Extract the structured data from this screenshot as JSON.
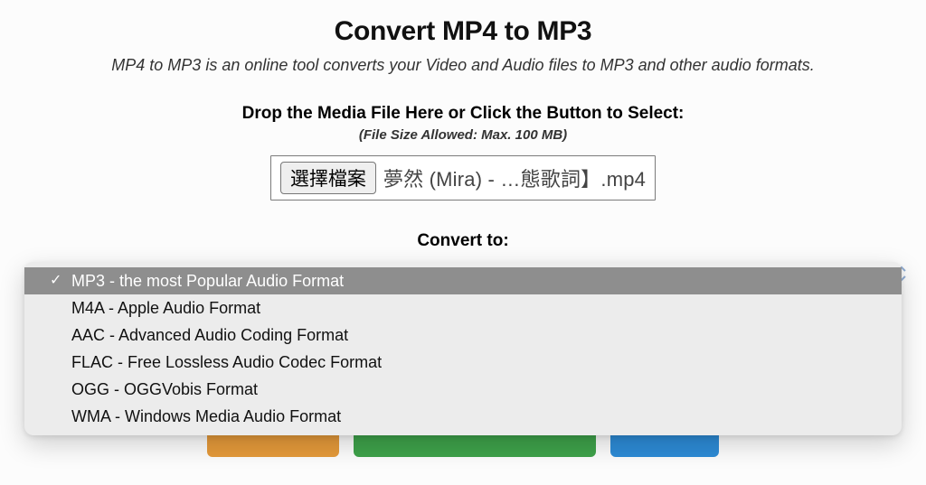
{
  "header": {
    "title": "Convert MP4 to MP3",
    "description": "MP4 to MP3 is an online tool converts your Video and Audio files to MP3 and other audio formats."
  },
  "upload": {
    "drop_label": "Drop the Media File Here or Click the Button to Select:",
    "size_note": "(File Size Allowed: Max. 100 MB)",
    "choose_button_label": "選擇檔案",
    "selected_file_display": "夢然 (Mira) - …態歌詞】.mp4"
  },
  "convert": {
    "label": "Convert to:",
    "options": [
      "MP3 - the most Popular Audio Format",
      "M4A - Apple Audio Format",
      "AAC - Advanced Audio Coding Format",
      "FLAC - Free Lossless Audio Codec Format",
      "OGG - OGGVobis Format",
      "WMA - Windows Media Audio Format"
    ],
    "selected_index": 0
  },
  "colors": {
    "button_orange": "#e59a3a",
    "button_green": "#3ea24a",
    "button_blue": "#2d8bd6"
  }
}
